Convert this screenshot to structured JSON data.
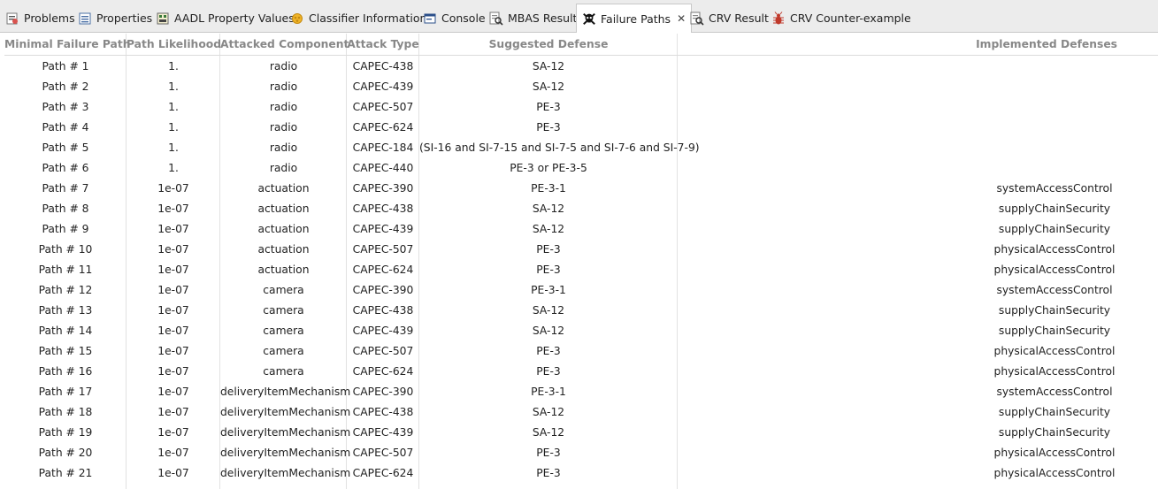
{
  "tabs": [
    {
      "label": "Problems",
      "icon": "problems-icon"
    },
    {
      "label": "Properties",
      "icon": "properties-icon"
    },
    {
      "label": "AADL Property Values",
      "icon": "aadl-property-values-icon"
    },
    {
      "label": "Classifier Information",
      "icon": "classifier-information-icon"
    },
    {
      "label": "Console",
      "icon": "console-icon"
    },
    {
      "label": "MBAS Result",
      "icon": "mbas-result-icon"
    },
    {
      "label": "Failure Paths",
      "icon": "skull-icon",
      "active": true
    },
    {
      "label": "CRV Result",
      "icon": "crv-result-icon"
    },
    {
      "label": "CRV Counter-example",
      "icon": "bug-icon"
    }
  ],
  "table": {
    "headers": [
      "Minimal Failure Path",
      "Path Likelihood",
      "Attacked Component",
      "Attack Type",
      "Suggested Defense",
      "Implemented Defenses"
    ],
    "rows": [
      [
        "Path # 1",
        "1.",
        "radio",
        "CAPEC-438",
        "SA-12",
        ""
      ],
      [
        "Path # 2",
        "1.",
        "radio",
        "CAPEC-439",
        "SA-12",
        ""
      ],
      [
        "Path # 3",
        "1.",
        "radio",
        "CAPEC-507",
        "PE-3",
        ""
      ],
      [
        "Path # 4",
        "1.",
        "radio",
        "CAPEC-624",
        "PE-3",
        ""
      ],
      [
        "Path # 5",
        "1.",
        "radio",
        "CAPEC-184",
        "(SI-16 and SI-7-15 and SI-7-5 and SI-7-6 and SI-7-9)",
        ""
      ],
      [
        "Path # 6",
        "1.",
        "radio",
        "CAPEC-440",
        "PE-3 or PE-3-5",
        ""
      ],
      [
        "Path # 7",
        "1e-07",
        "actuation",
        "CAPEC-390",
        "PE-3-1",
        "systemAccessControl"
      ],
      [
        "Path # 8",
        "1e-07",
        "actuation",
        "CAPEC-438",
        "SA-12",
        "supplyChainSecurity"
      ],
      [
        "Path # 9",
        "1e-07",
        "actuation",
        "CAPEC-439",
        "SA-12",
        "supplyChainSecurity"
      ],
      [
        "Path # 10",
        "1e-07",
        "actuation",
        "CAPEC-507",
        "PE-3",
        "physicalAccessControl"
      ],
      [
        "Path # 11",
        "1e-07",
        "actuation",
        "CAPEC-624",
        "PE-3",
        "physicalAccessControl"
      ],
      [
        "Path # 12",
        "1e-07",
        "camera",
        "CAPEC-390",
        "PE-3-1",
        "systemAccessControl"
      ],
      [
        "Path # 13",
        "1e-07",
        "camera",
        "CAPEC-438",
        "SA-12",
        "supplyChainSecurity"
      ],
      [
        "Path # 14",
        "1e-07",
        "camera",
        "CAPEC-439",
        "SA-12",
        "supplyChainSecurity"
      ],
      [
        "Path # 15",
        "1e-07",
        "camera",
        "CAPEC-507",
        "PE-3",
        "physicalAccessControl"
      ],
      [
        "Path # 16",
        "1e-07",
        "camera",
        "CAPEC-624",
        "PE-3",
        "physicalAccessControl"
      ],
      [
        "Path # 17",
        "1e-07",
        "deliveryItemMechanism",
        "CAPEC-390",
        "PE-3-1",
        "systemAccessControl"
      ],
      [
        "Path # 18",
        "1e-07",
        "deliveryItemMechanism",
        "CAPEC-438",
        "SA-12",
        "supplyChainSecurity"
      ],
      [
        "Path # 19",
        "1e-07",
        "deliveryItemMechanism",
        "CAPEC-439",
        "SA-12",
        "supplyChainSecurity"
      ],
      [
        "Path # 20",
        "1e-07",
        "deliveryItemMechanism",
        "CAPEC-507",
        "PE-3",
        "physicalAccessControl"
      ],
      [
        "Path # 21",
        "1e-07",
        "deliveryItemMechanism",
        "CAPEC-624",
        "PE-3",
        "physicalAccessControl"
      ]
    ]
  }
}
